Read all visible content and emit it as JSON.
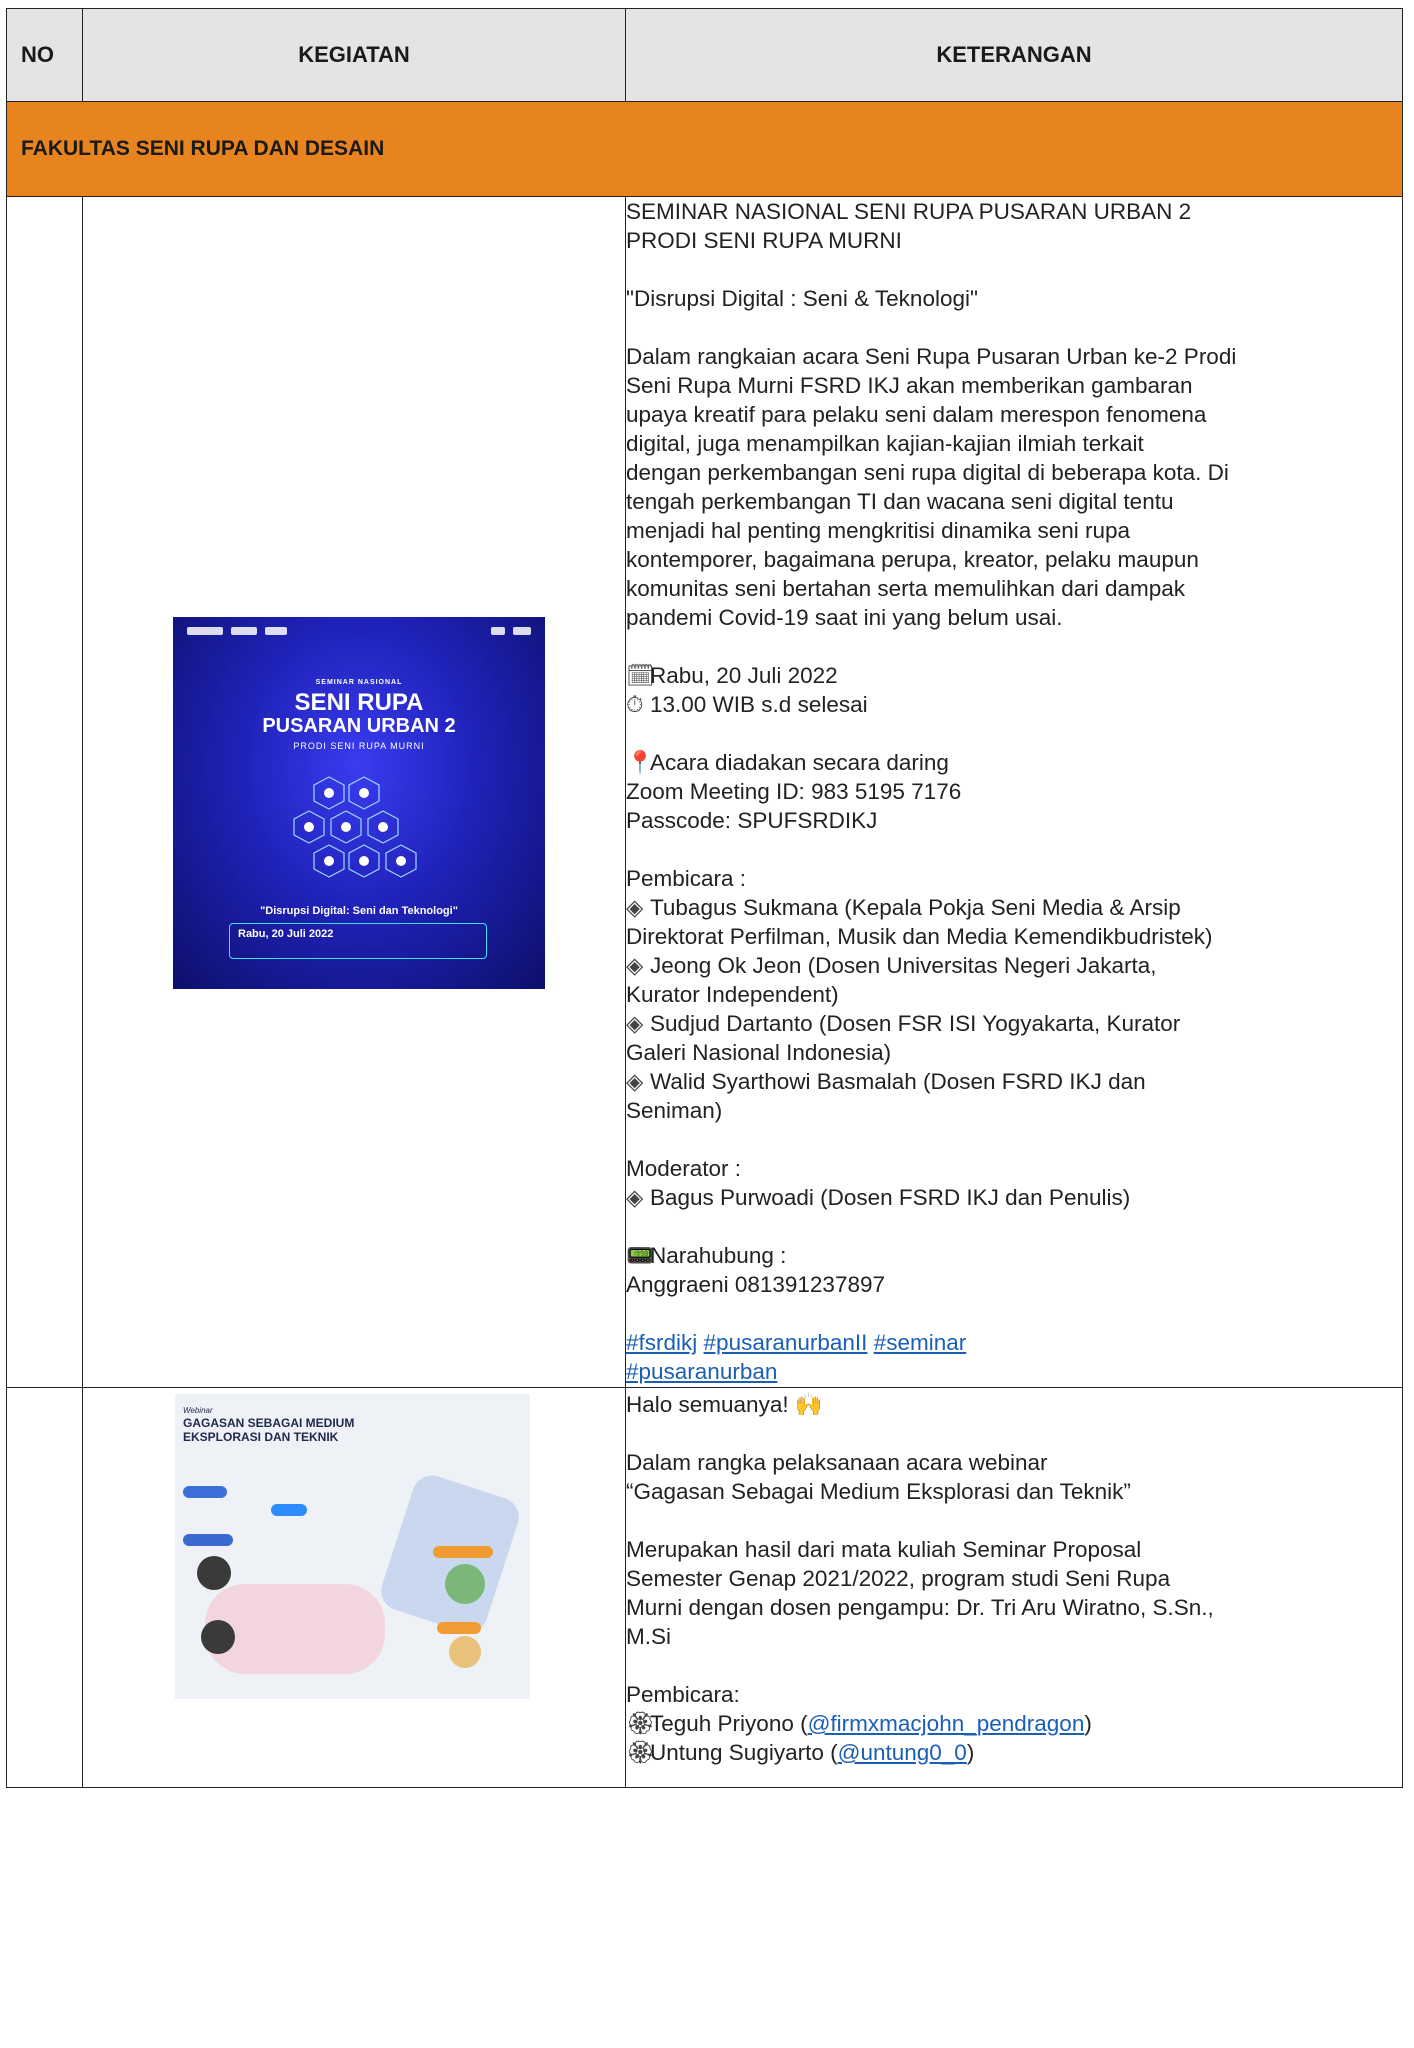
{
  "table": {
    "headers": {
      "no": "NO",
      "kegiatan": "KEGIATAN",
      "keterangan": "KETERANGAN"
    },
    "faculty": "FAKULTAS SENI RUPA DAN DESAIN"
  },
  "row1": {
    "title1": "SEMINAR NASIONAL SENI RUPA PUSARAN URBAN 2",
    "title2": "PRODI SENI RUPA MURNI",
    "theme": "\"Disrupsi Digital : Seni & Teknologi\"",
    "description": [
      "Dalam rangkaian acara Seni Rupa Pusaran Urban ke-2 Prodi",
      "Seni Rupa Murni FSRD IKJ akan memberikan gambaran",
      "upaya kreatif para pelaku seni dalam merespon fenomena",
      "digital, juga menampilkan kajian-kajian ilmiah terkait",
      "dengan perkembangan seni rupa digital di beberapa kota. Di",
      "tengah perkembangan TI dan wacana seni digital tentu",
      "menjadi hal penting mengkritisi dinamika seni rupa",
      "kontemporer, bagaimana perupa, kreator, pelaku maupun",
      "komunitas seni bertahan serta memulihkan dari dampak",
      "pandemi Covid-19 saat ini yang belum usai."
    ],
    "date": "Rabu, 20 Juli 2022",
    "time": "13.00 WIB s.d selesai",
    "venue": "Acara diadakan secara daring",
    "zoom_id": "Zoom Meeting ID: 983 5195 7176",
    "passcode": "Passcode: SPUFSRDIKJ",
    "speakers_label": "Pembicara :",
    "speakers": [
      [
        "Tubagus Sukmana (Kepala Pokja Seni Media & Arsip",
        "Direktorat Perfilman, Musik dan Media Kemendikbudristek)"
      ],
      [
        "Jeong Ok Jeon (Dosen Universitas Negeri Jakarta,",
        "Kurator Independent)"
      ],
      [
        "Sudjud Dartanto (Dosen FSR ISI Yogyakarta, Kurator",
        "Galeri Nasional Indonesia)"
      ],
      [
        "Walid Syarthowi Basmalah (Dosen FSRD IKJ dan",
        "Seniman)"
      ]
    ],
    "moderator_label": "Moderator :",
    "moderator": "Bagus Purwoadi (Dosen FSRD IKJ dan Penulis)",
    "contact_label": "Narahubung :",
    "contact": "Anggraeni 081391237897",
    "hashtags": [
      "#fsrdikj",
      "#pusaranurbanII",
      "#seminar",
      "#pusaranurban"
    ],
    "poster": {
      "seminar": "SEMINAR NASIONAL",
      "line1": "SENI RUPA",
      "line2": "PUSARAN URBAN 2",
      "line3": "PRODI SENI RUPA MURNI",
      "quote": "\"Disrupsi Digital: Seni dan Teknologi\"",
      "date": "Rabu, 20 Juli 2022"
    }
  },
  "row2": {
    "greeting": "Halo semuanya!",
    "intro1": "Dalam rangka pelaksanaan acara webinar",
    "intro2": "“Gagasan Sebagai Medium Eksplorasi dan Teknik”",
    "body": [
      "Merupakan hasil dari mata kuliah Seminar Proposal",
      "Semester Genap 2021/2022, program studi Seni Rupa",
      "Murni dengan dosen pengampu: Dr. Tri Aru Wiratno, S.Sn.,",
      "M.Si"
    ],
    "speakers_label": "Pembicara:",
    "speakers": [
      {
        "name": "Teguh Priyono (",
        "handle": "@firmxmacjohn_pendragon",
        "close": ")"
      },
      {
        "name": "Untung Sugiyarto (",
        "handle": "@untung0_0",
        "close": ")"
      }
    ],
    "poster": {
      "webinar": "Webinar",
      "title": "GAGASAN SEBAGAI MEDIUM EKSPLORASI DAN TEKNIK"
    }
  },
  "icons": {
    "calendar": "calendar-icon",
    "clock": "clock-icon",
    "pin": "location-pin-icon",
    "diamond": "diamond-bullet-icon",
    "phone": "phone-icon",
    "hands": "raised-hands-icon",
    "bullet": "fancy-bullet-icon"
  },
  "colors": {
    "faculty_bg": "#e8841f",
    "header_bg": "#e4e4e4",
    "link": "#1a5fb4"
  }
}
